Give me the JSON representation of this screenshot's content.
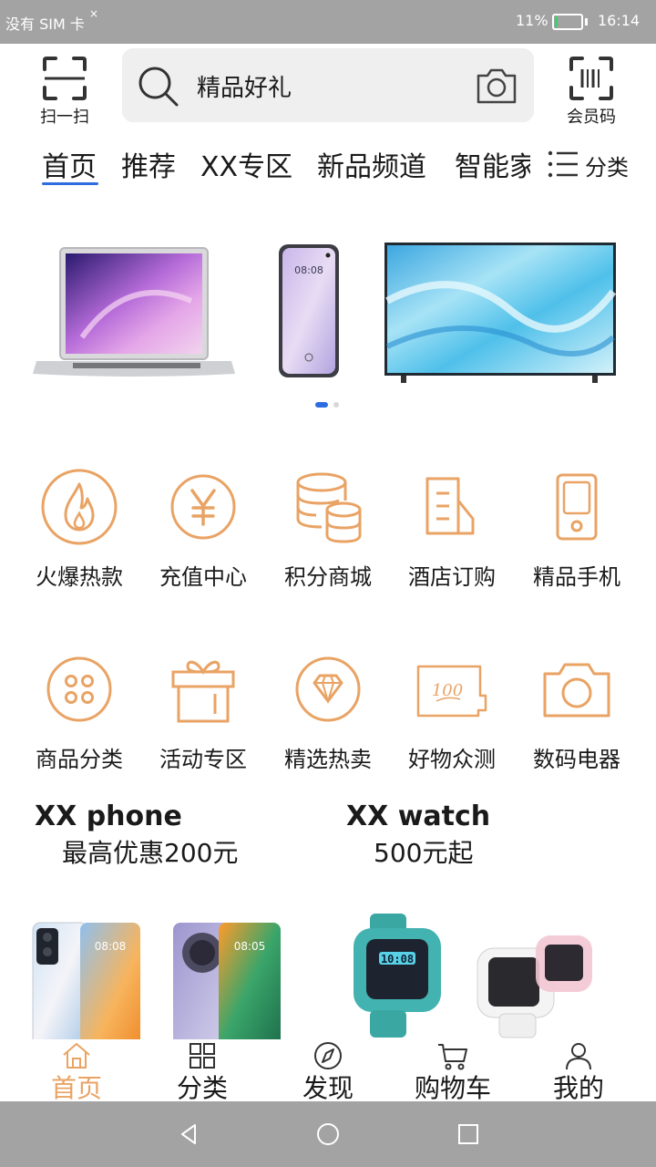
{
  "status_bar": {
    "carrier": "没有 SIM 卡",
    "carrier_mark": "×",
    "battery_percent": "11%",
    "battery_level": 0.11,
    "time": "16:14"
  },
  "header": {
    "scan_label": "扫一扫",
    "search_text": "精品好礼",
    "member_label": "会员码"
  },
  "tabs": {
    "items": [
      "首页",
      "推荐",
      "XX专区",
      "新品频道",
      "智能家"
    ],
    "active_index": 0,
    "category_label": "分类"
  },
  "banner": {
    "slide_count": 2,
    "active_slide": 0,
    "phone_screen_time": "08:08"
  },
  "quick_entries": [
    {
      "label": "火爆热款",
      "icon": "fire-icon"
    },
    {
      "label": "充值中心",
      "icon": "yen-coin-icon"
    },
    {
      "label": "积分商城",
      "icon": "coins-stack-icon"
    },
    {
      "label": "酒店订购",
      "icon": "hotel-building-icon"
    },
    {
      "label": "精品手机",
      "icon": "phone-icon"
    },
    {
      "label": "商品分类",
      "icon": "grid-dots-icon"
    },
    {
      "label": "活动专区",
      "icon": "gift-box-icon"
    },
    {
      "label": "精选热卖",
      "icon": "diamond-icon"
    },
    {
      "label": "好物众测",
      "icon": "ticket-icon"
    },
    {
      "label": "数码电器",
      "icon": "camera-icon"
    }
  ],
  "promos": [
    {
      "title": "XX phone",
      "subtitle": "最高优惠200元",
      "screen_times": [
        "08:08",
        "08:05"
      ]
    },
    {
      "title": "XX watch",
      "subtitle": "500元起",
      "screen_time": "10:08"
    }
  ],
  "ticket_icon_text": "100",
  "bottom_nav": {
    "items": [
      "首页",
      "分类",
      "发现",
      "购物车",
      "我的"
    ],
    "active_index": 0
  },
  "colors": {
    "accent_orange": "#e9a364",
    "tab_indicator": "#2d6de0",
    "status_bar": "#a3a3a3",
    "battery_green": "#3bd16f"
  }
}
